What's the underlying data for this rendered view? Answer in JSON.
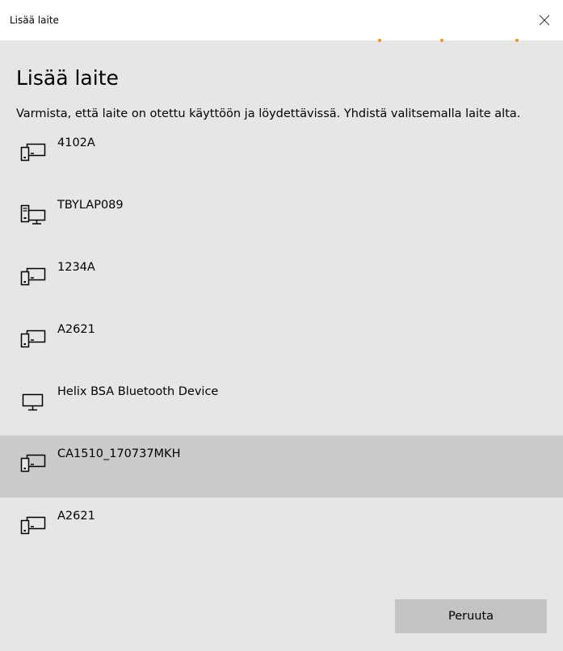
{
  "window": {
    "title": "Lisää laite",
    "close_icon": "close-icon"
  },
  "main": {
    "heading": "Lisää laite",
    "instructions": "Varmista, että laite on otettu käyttöön ja löydettävissä. Yhdistä valitsemalla laite alta."
  },
  "devices": [
    {
      "name": "4102A",
      "icon": "phone-pc-icon",
      "selected": false
    },
    {
      "name": "TBYLAP089",
      "icon": "computer-phone-icon",
      "selected": false
    },
    {
      "name": "1234A",
      "icon": "phone-pc-icon",
      "selected": false
    },
    {
      "name": "A2621",
      "icon": "phone-pc-icon",
      "selected": false
    },
    {
      "name": "Helix BSA Bluetooth Device",
      "icon": "monitor-icon",
      "selected": false
    },
    {
      "name": "CA1510_170737MKH",
      "icon": "phone-pc-icon",
      "selected": true
    },
    {
      "name": "A2621",
      "icon": "phone-pc-icon",
      "selected": false
    }
  ],
  "footer": {
    "cancel_label": "Peruuta"
  },
  "colors": {
    "background": "#e6e6e6",
    "titlebar": "#ffffff",
    "selected_row": "#cbcbcb",
    "button": "#c3c3c3",
    "progress_dots": "#f7901e"
  }
}
